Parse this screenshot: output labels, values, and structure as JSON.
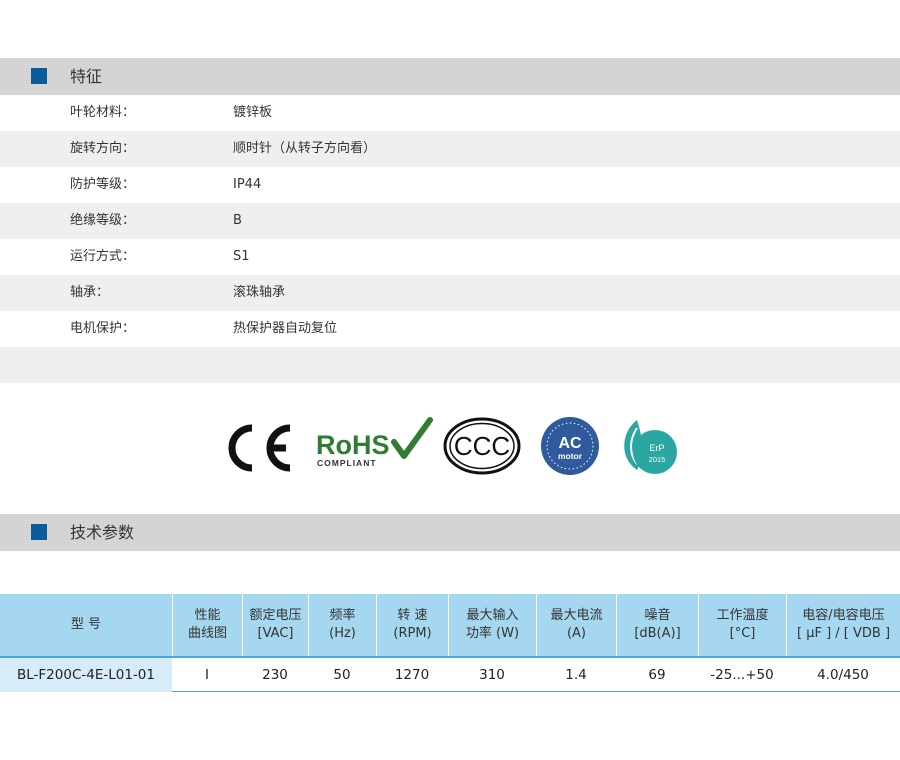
{
  "features_section": {
    "title": "特征",
    "rows": [
      {
        "label": "叶轮材料：",
        "value": "镀锌板"
      },
      {
        "label": "旋转方向：",
        "value": "顺时针（从转子方向看）"
      },
      {
        "label": "防护等级：",
        "value": "IP44"
      },
      {
        "label": "绝缘等级：",
        "value": "B"
      },
      {
        "label": "运行方式：",
        "value": "S1"
      },
      {
        "label": "轴承：",
        "value": "滚珠轴承"
      },
      {
        "label": "电机保护：",
        "value": "热保护器自动复位"
      },
      {
        "label": "",
        "value": ""
      }
    ]
  },
  "certifications": {
    "ce": "CE",
    "rohs": {
      "main": "RoHS",
      "sub": "COMPLIANT"
    },
    "ccc": "CCC",
    "ac_motor": {
      "line1": "AC",
      "line2": "motor"
    },
    "erp": {
      "line1": "ErP",
      "line2": "2015"
    }
  },
  "tech_section": {
    "title": "技术参数"
  },
  "spec_table": {
    "headers": [
      "型 号",
      "性能\n曲线图",
      "额定电压\n[VAC]",
      "频率\n(Hz)",
      "转 速\n(RPM)",
      "最大输入\n功率 (W)",
      "最大电流\n(A)",
      "噪音\n[dB(A)]",
      "工作温度\n[°C]",
      "电容/电容电压\n[ μF ] / [ VDB ]"
    ],
    "row": [
      "BL-F200C-4E-L01-01",
      "I",
      "230",
      "50",
      "1270",
      "310",
      "1.4",
      "69",
      "-25...+50",
      "4.0/450"
    ]
  },
  "colors": {
    "section_header_bg": "#d4d4d4",
    "accent_square": "#0a5a9c",
    "table_header_bg": "#a6d7f0",
    "table_border": "#4aa8dc",
    "model_cell_bg": "#d6ecf8"
  }
}
